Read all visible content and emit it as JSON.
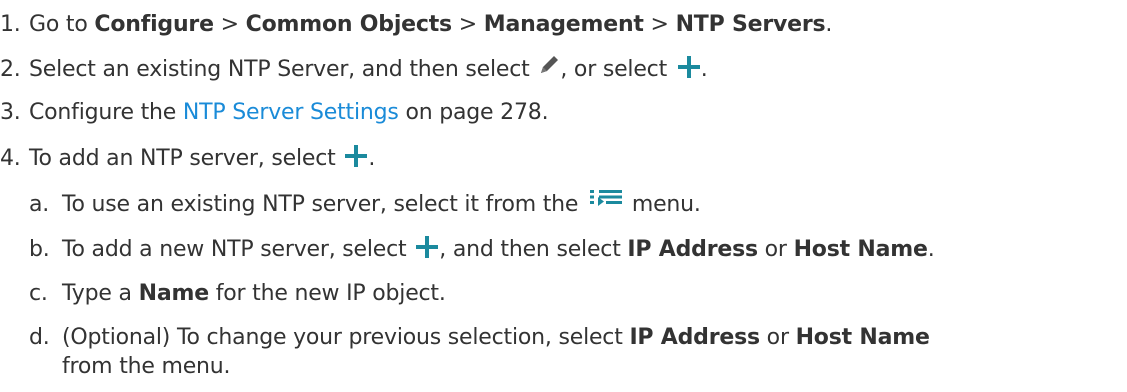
{
  "steps": {
    "s1": {
      "num": "1.",
      "t1": "Go to ",
      "b1": "Configure",
      "t2": " > ",
      "b2": "Common Objects",
      "t3": " > ",
      "b3": "Management",
      "t4": " > ",
      "b4": "NTP Servers",
      "t5": "."
    },
    "s2": {
      "num": "2.",
      "t1": "Select an existing NTP Server, and then select ",
      "t2": ", or select ",
      "t3": "."
    },
    "s3": {
      "num": "3.",
      "t1": "Configure the ",
      "link": "NTP Server Settings",
      "t2": " on page 278."
    },
    "s4": {
      "num": "4.",
      "t1": "To add an NTP server, select ",
      "t2": "."
    },
    "sa": {
      "num": "a.",
      "t1": "To use an existing NTP server, select it from the ",
      "t2": " menu."
    },
    "sb": {
      "num": "b.",
      "t1": "To add a new NTP server, select ",
      "t2": ", and then select ",
      "b1": "IP Address",
      "t3": " or ",
      "b2": "Host Name",
      "t4": "."
    },
    "sc": {
      "num": "c.",
      "t1": "Type a ",
      "b1": "Name",
      "t2": " for the new IP object."
    },
    "sd": {
      "num": "d.",
      "t1": "(Optional) To change your previous selection, select ",
      "b1": "IP Address",
      "t2": " or ",
      "b2": "Host Name",
      "t3": "from the menu."
    }
  },
  "icons": {
    "plus": "plus-icon",
    "pencil": "pencil-icon",
    "list": "list-menu-icon"
  },
  "colors": {
    "text": "#333333",
    "link": "#1a8bd8",
    "icon_teal": "#1b8a9e",
    "pencil_gray": "#555555"
  }
}
